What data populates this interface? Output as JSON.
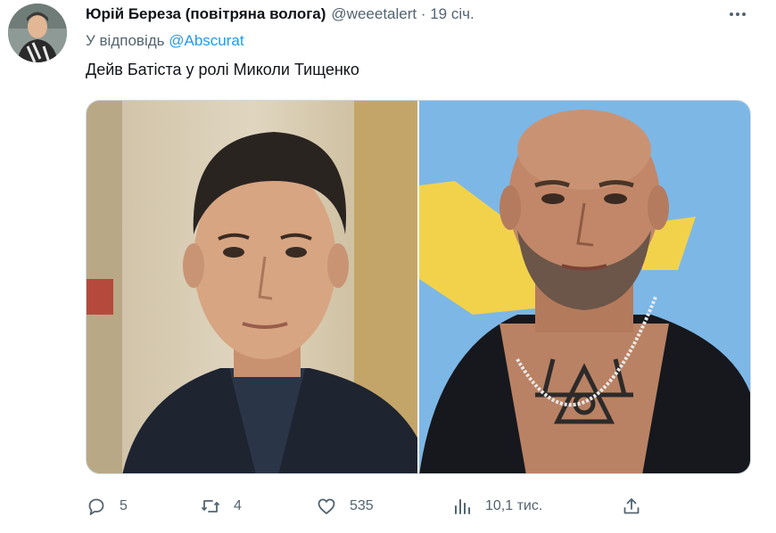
{
  "tweet": {
    "author_name": "Юрій Береза (повітряна волога)",
    "handle_time": "@weeetalert · 19 січ.",
    "more_icon": "ellipsis-icon",
    "reply_prefix": "У відповідь",
    "reply_mention": "@Abscurat",
    "text": "Дейв Батіста у ролі Миколи Тищенко"
  },
  "actions": {
    "replies": "5",
    "retweets": "4",
    "likes": "535",
    "views": "10,1 тис."
  },
  "colors": {
    "link": "#1d9bf0",
    "secondary_text": "#536471",
    "right_photo_bg": "#7db7e6",
    "right_photo_shape": "#f2d24b"
  }
}
